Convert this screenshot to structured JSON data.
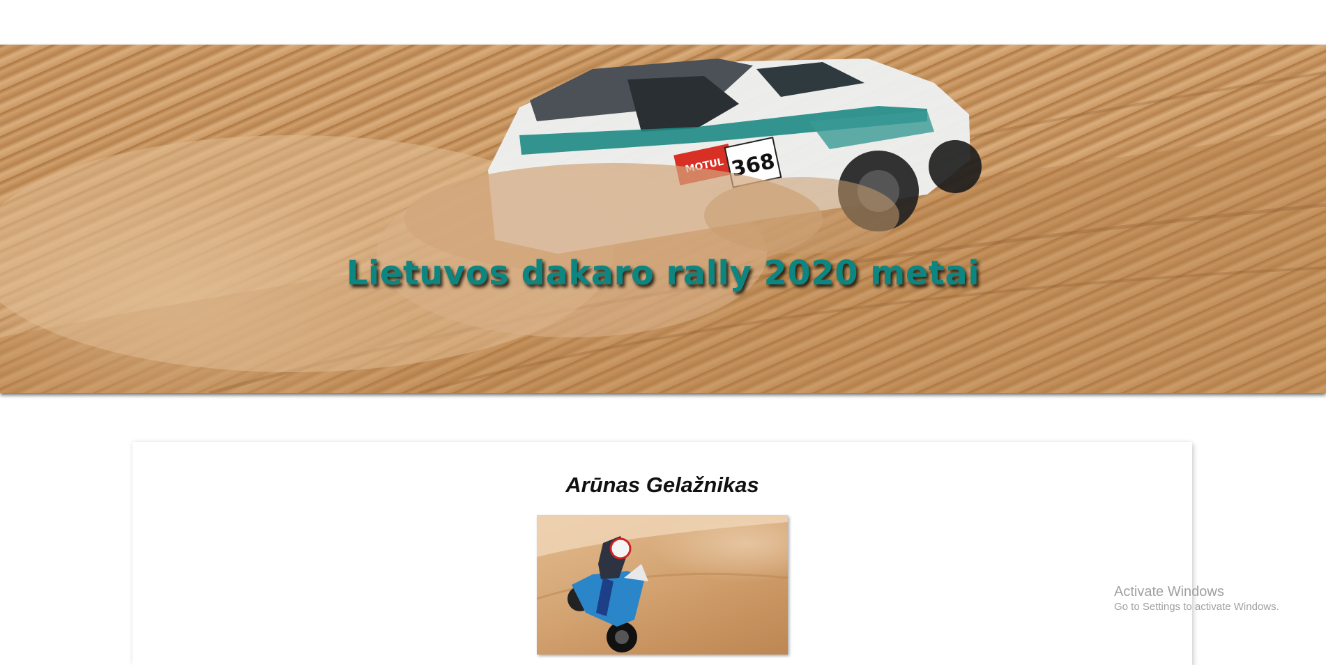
{
  "hero": {
    "title": "Lietuvos dakaro rally 2020 metai",
    "car_number": "368",
    "sponsor_text": "MOTUL",
    "title_color": "#0d8580"
  },
  "card": {
    "title": "Arūnas Gelažnikas"
  },
  "watermark": {
    "title": "Activate Windows",
    "subtitle": "Go to Settings to activate Windows."
  }
}
